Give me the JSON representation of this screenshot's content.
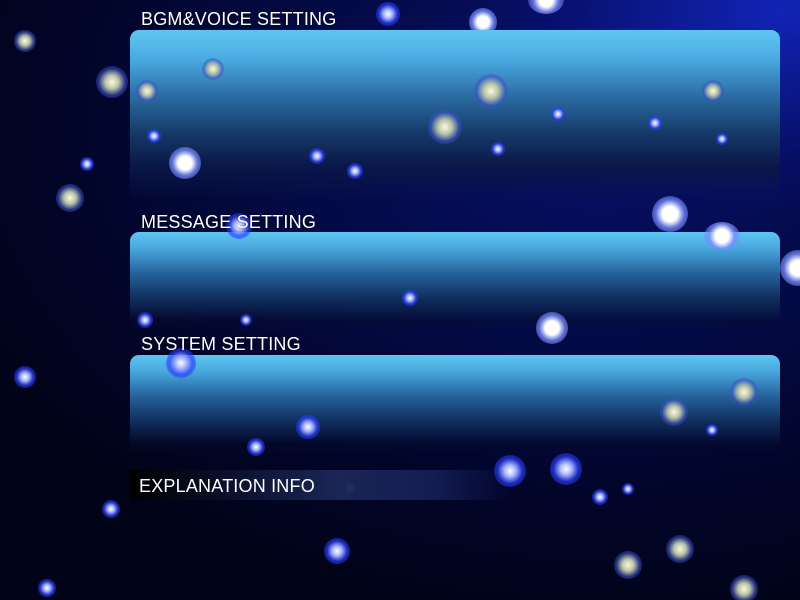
{
  "sections": {
    "bgm_voice": {
      "title": "BGM&VOICE SETTING"
    },
    "message": {
      "title": "MESSAGE SETTING"
    },
    "system": {
      "title": "SYSTEM SETTING"
    }
  },
  "explanation": {
    "label": "EXPLANATION INFO"
  },
  "colors": {
    "panel_top": "#5ec6f2",
    "panel_mid": "#256099",
    "background": "#020522",
    "particle": "#4060ff"
  }
}
